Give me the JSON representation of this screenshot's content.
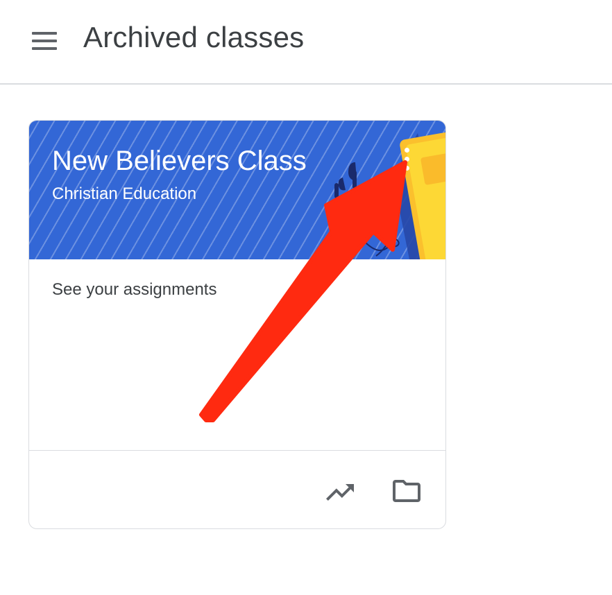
{
  "header": {
    "title": "Archived classes",
    "menu_icon": "hamburger-menu-icon"
  },
  "class_card": {
    "name": "New Believers Class",
    "section": "Christian Education",
    "more_icon": "more-vert-icon",
    "body_link": "See your assignments",
    "footer_icons": [
      "trending-up-icon",
      "folder-icon"
    ],
    "banner_color": "#3367d6"
  },
  "annotation": {
    "arrow_icon": "red-arrow-annotation",
    "arrow_color": "#ff2a10"
  }
}
